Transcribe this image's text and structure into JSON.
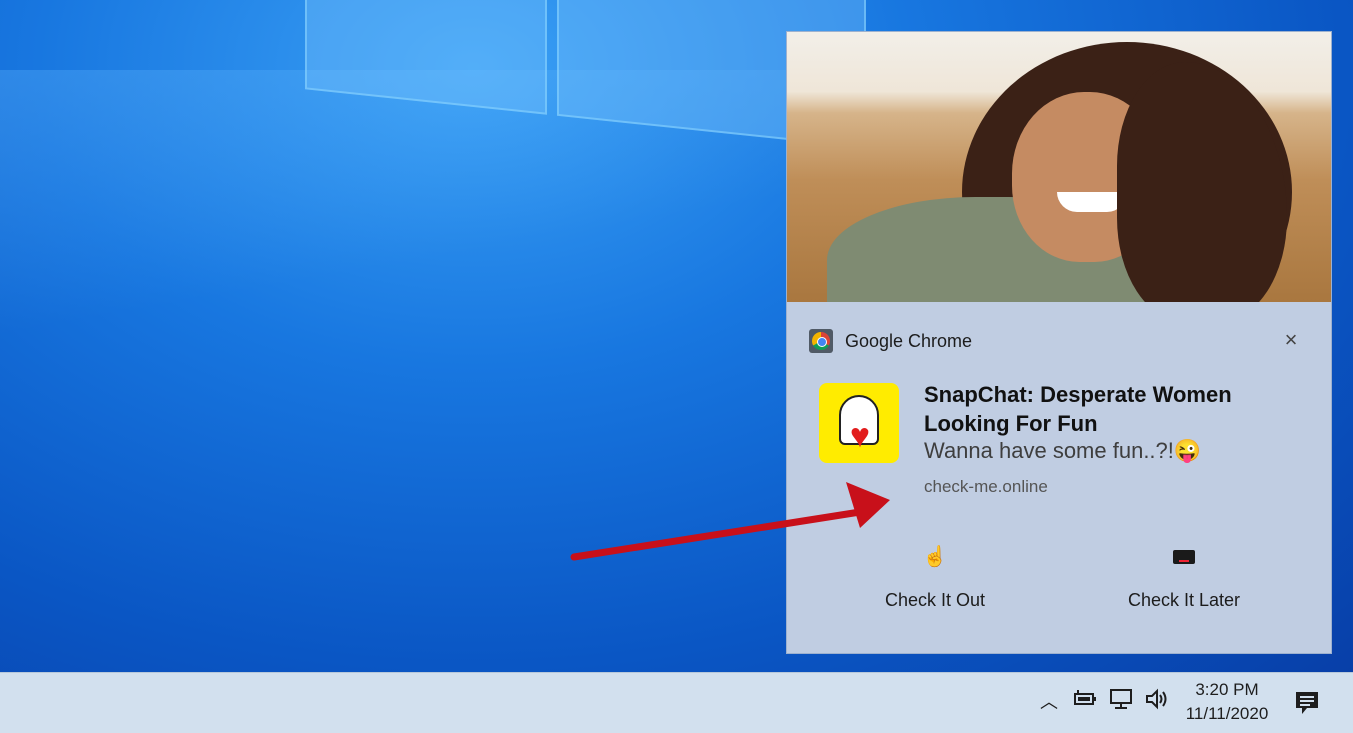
{
  "toast": {
    "app_name": "Google Chrome",
    "close_glyph": "×",
    "title": "SnapChat: Desperate Women Looking For Fun",
    "body": "Wanna have some fun..?!😜",
    "source_url": "check-me.online",
    "actions": [
      {
        "label": "Check It Out",
        "icon": "hand-pointer-icon"
      },
      {
        "label": "Check It Later",
        "icon": "keyboard-icon"
      }
    ]
  },
  "taskbar": {
    "time": "3:20 PM",
    "date": "11/11/2020",
    "tray_icons": [
      "chevron-up-icon",
      "battery-icon",
      "network-icon",
      "volume-icon",
      "action-center-icon"
    ]
  },
  "colors": {
    "toast_bg": "#c0cde2",
    "arrow": "#c8101a",
    "snapchat_yellow": "#ffec00"
  }
}
